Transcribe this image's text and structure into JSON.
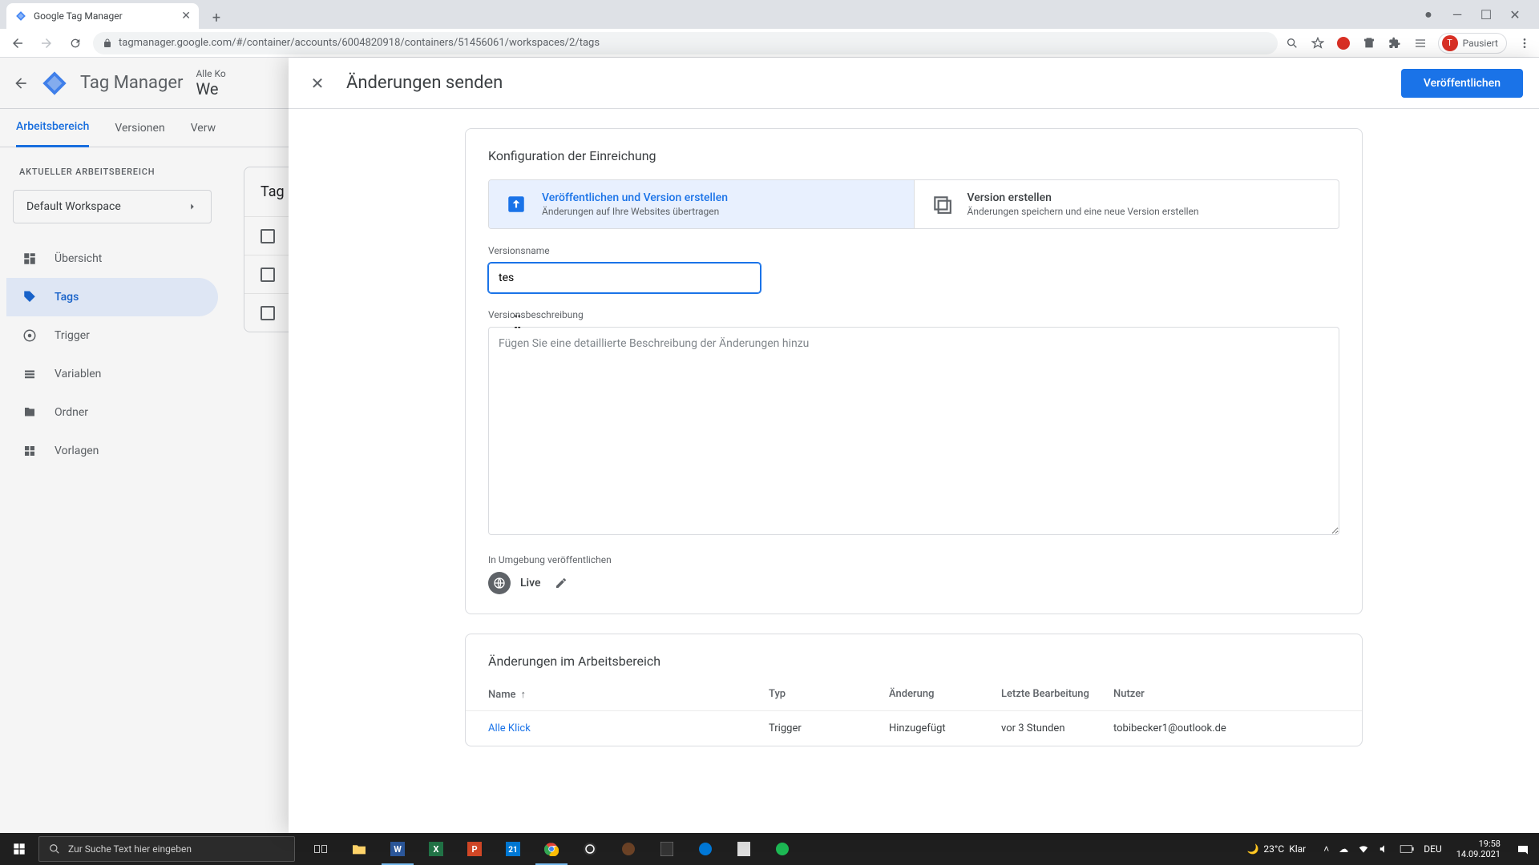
{
  "browser": {
    "tab_title": "Google Tag Manager",
    "url": "tagmanager.google.com/#/container/accounts/6004820918/containers/51456061/workspaces/2/tags",
    "profile_label": "Pausiert",
    "profile_initial": "T"
  },
  "gtm": {
    "app_name": "Tag Manager",
    "breadcrumb": "Alle Ko",
    "workspace_big": "We",
    "tabs": {
      "workspace": "Arbeitsbereich",
      "versions": "Versionen",
      "admin": "Verw"
    },
    "sidebar": {
      "current_label": "AKTUELLER ARBEITSBEREICH",
      "workspace": "Default Workspace",
      "items": [
        {
          "label": "Übersicht"
        },
        {
          "label": "Tags"
        },
        {
          "label": "Trigger"
        },
        {
          "label": "Variablen"
        },
        {
          "label": "Ordner"
        },
        {
          "label": "Vorlagen"
        }
      ]
    },
    "main_heading": "Tag"
  },
  "modal": {
    "title": "Änderungen senden",
    "publish_button": "Veröffentlichen",
    "config_title": "Konfiguration der Einreichung",
    "option_publish": {
      "title": "Veröffentlichen und Version erstellen",
      "sub": "Änderungen auf Ihre Websites übertragen"
    },
    "option_version": {
      "title": "Version erstellen",
      "sub": "Änderungen speichern und eine neue Version erstellen"
    },
    "version_name_label": "Versionsname",
    "version_name_value": "tes",
    "version_desc_label": "Versionsbeschreibung",
    "version_desc_placeholder": "Fügen Sie eine detaillierte Beschreibung der Änderungen hinzu",
    "env_label": "In Umgebung veröffentlichen",
    "env_name": "Live",
    "changes_title": "Änderungen im Arbeitsbereich",
    "columns": {
      "name": "Name",
      "type": "Typ",
      "change": "Änderung",
      "last_edit": "Letzte Bearbeitung",
      "user": "Nutzer"
    },
    "row": {
      "name": "Alle Klick",
      "type": "Trigger",
      "change": "Hinzugefügt",
      "last_edit": "vor 3 Stunden",
      "user": "tobibecker1@outlook.de"
    }
  },
  "taskbar": {
    "search_placeholder": "Zur Suche Text hier eingeben",
    "weather_temp": "23°C",
    "weather_text": "Klar",
    "lang": "DEU",
    "time": "19:58",
    "date": "14.09.2021"
  }
}
